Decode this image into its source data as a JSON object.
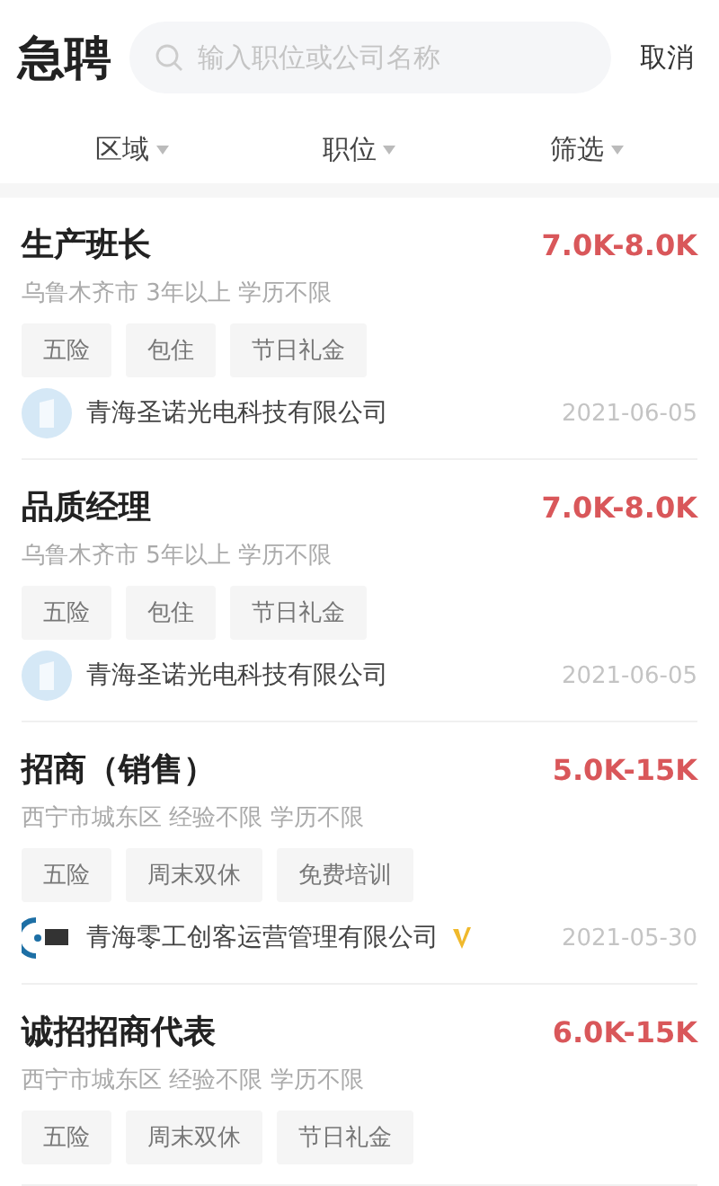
{
  "header": {
    "title": "急聘",
    "search": {
      "placeholder": "输入职位或公司名称"
    },
    "cancel": "取消"
  },
  "filters": [
    {
      "label": "区域"
    },
    {
      "label": "职位"
    },
    {
      "label": "筛选"
    }
  ],
  "jobs": [
    {
      "title": "生产班长",
      "salary": "7.0K-8.0K",
      "meta": "乌鲁木齐市 3年以上 学历不限",
      "tags": [
        "五险",
        "包住",
        "节日礼金"
      ],
      "company": "青海圣诺光电科技有限公司",
      "logo": {
        "kind": "light"
      },
      "verified": false,
      "date": "2021-06-05"
    },
    {
      "title": "品质经理",
      "salary": "7.0K-8.0K",
      "meta": "乌鲁木齐市 5年以上 学历不限",
      "tags": [
        "五险",
        "包住",
        "节日礼金"
      ],
      "company": "青海圣诺光电科技有限公司",
      "logo": {
        "kind": "light"
      },
      "verified": false,
      "date": "2021-06-05"
    },
    {
      "title": "招商（销售）",
      "salary": "5.0K-15K",
      "meta": "西宁市城东区 经验不限 学历不限",
      "tags": [
        "五险",
        "周末双休",
        "免费培训"
      ],
      "company": "青海零工创客运营管理有限公司",
      "logo": {
        "kind": "dark"
      },
      "verified": true,
      "date": "2021-05-30"
    },
    {
      "title": "诚招招商代表",
      "salary": "6.0K-15K",
      "meta": "西宁市城东区 经验不限 学历不限",
      "tags": [
        "五险",
        "周末双休",
        "节日礼金"
      ]
    }
  ]
}
